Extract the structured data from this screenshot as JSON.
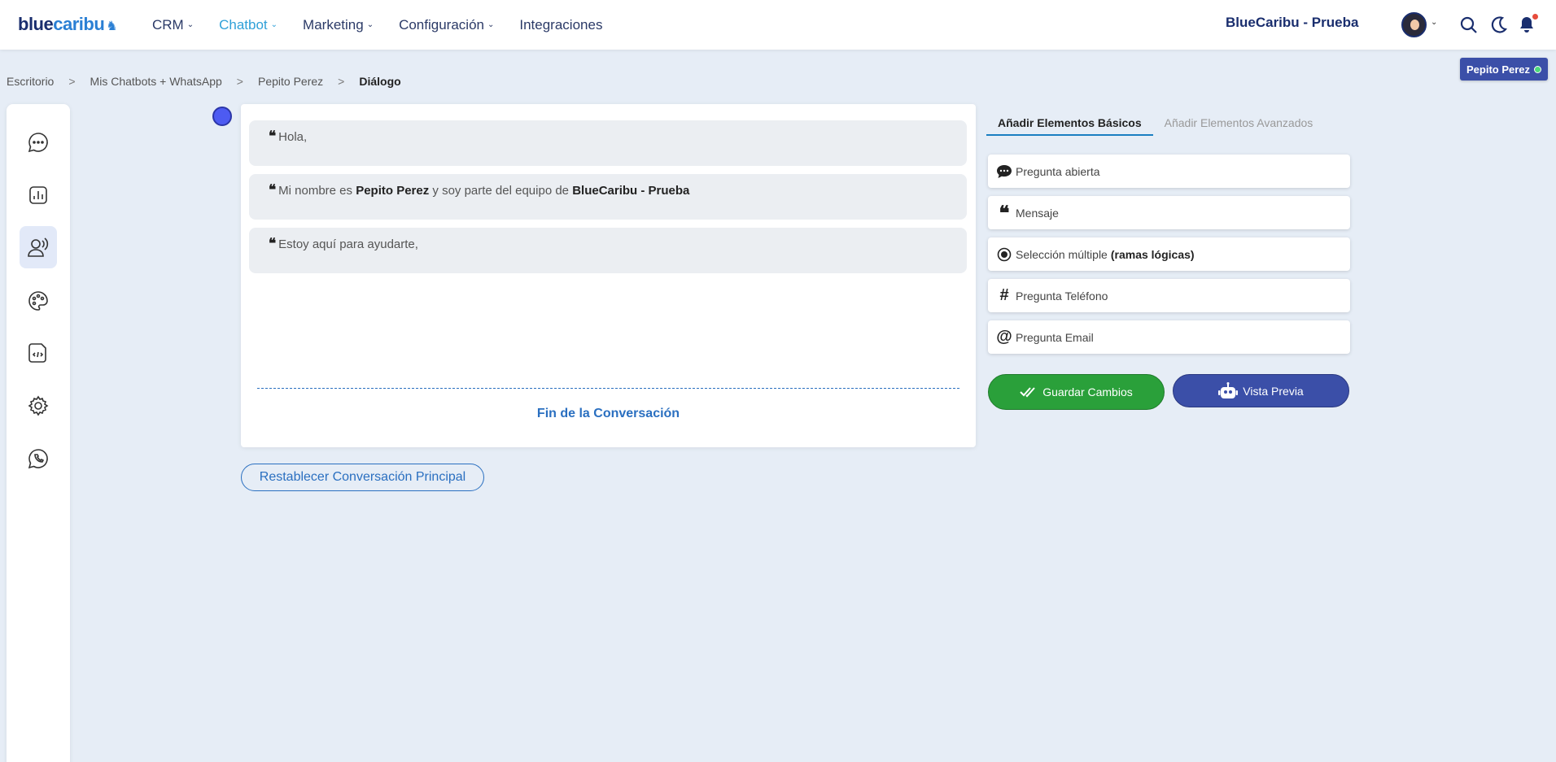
{
  "header": {
    "logo_part1": "blue",
    "logo_part2": "caribu",
    "nav": [
      {
        "label": "CRM",
        "chevron": "⌄"
      },
      {
        "label": "Chatbot",
        "chevron": "⌄"
      },
      {
        "label": "Marketing",
        "chevron": "⌄"
      },
      {
        "label": "Configuración",
        "chevron": "⌄"
      },
      {
        "label": "Integraciones",
        "chevron": ""
      }
    ],
    "company": "BlueCaribu - Prueba"
  },
  "breadcrumb": {
    "items": [
      "Escritorio",
      "Mis Chatbots + WhatsApp",
      "Pepito Perez"
    ],
    "current": "Diálogo",
    "separator": ">"
  },
  "user_badge": {
    "name": "Pepito Perez"
  },
  "sidebar": {
    "icons": [
      "chat-bubble-icon",
      "bar-chart-icon",
      "user-voice-icon",
      "palette-icon",
      "document-code-icon",
      "gear-icon",
      "whatsapp-icon"
    ]
  },
  "dialog": {
    "messages": [
      {
        "parts": [
          {
            "t": "Hola,",
            "b": false
          }
        ]
      },
      {
        "parts": [
          {
            "t": "Mi nombre es ",
            "b": false
          },
          {
            "t": "Pepito Perez",
            "b": true
          },
          {
            "t": " y soy parte del equipo de ",
            "b": false
          },
          {
            "t": "BlueCaribu - Prueba",
            "b": true
          }
        ]
      },
      {
        "parts": [
          {
            "t": "Estoy aquí para ayudarte,",
            "b": false
          }
        ]
      }
    ],
    "quote_glyph": "❝",
    "end_label": "Fin de la Conversación"
  },
  "reset_button": "Restablecer Conversación Principal",
  "tabs": {
    "basic": "Añadir Elementos Básicos",
    "advanced": "Añadir Elementos Avanzados"
  },
  "elements": [
    {
      "label": "Pregunta abierta",
      "bold": "",
      "icon": "speech-bubble-icon"
    },
    {
      "label": "Mensaje",
      "bold": "",
      "icon": "quote-icon"
    },
    {
      "label": "Selección múltiple",
      "bold": "(ramas lógicas)",
      "icon": "radio-icon"
    },
    {
      "label": "Pregunta Teléfono",
      "bold": "",
      "icon": "hash-icon"
    },
    {
      "label": "Pregunta Email",
      "bold": "",
      "icon": "at-icon"
    }
  ],
  "actions": {
    "save": "Guardar Cambios",
    "preview": "Vista Previa"
  },
  "colors": {
    "primary_navy": "#1a2e6e",
    "accent_blue": "#2a6fc0",
    "save_green": "#2aa03a",
    "preview_indigo": "#3b4fa8",
    "page_bg": "#e6edf6"
  }
}
